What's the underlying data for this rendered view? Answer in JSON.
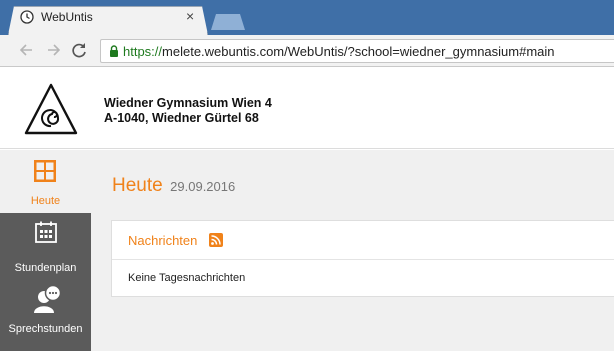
{
  "browser": {
    "tab_title": "WebUntis",
    "close_symbol": "×",
    "url_secure": "https://",
    "url_rest": "melete.webuntis.com/WebUntis/?school=wiedner_gymnasium#main"
  },
  "header": {
    "school_name": "Wiedner Gymnasium Wien 4",
    "school_address": "A-1040, Wiedner Gürtel 68"
  },
  "sidebar": {
    "items": [
      {
        "label": "Heute",
        "icon": "dashboard-grid-icon",
        "active": true
      },
      {
        "label": "Stundenplan",
        "icon": "calendar-icon",
        "active": false
      },
      {
        "label": "Sprechstunden",
        "icon": "consultation-chat-icon",
        "active": false
      }
    ]
  },
  "main": {
    "title": "Heute",
    "date": "29.09.2016",
    "news": {
      "title": "Nachrichten",
      "empty_text": "Keine Tagesnachrichten"
    }
  },
  "colors": {
    "accent": "#f0821a",
    "sidebar_bg": "#5b5b5b",
    "content_bg": "#f0f0f0",
    "browser_frame": "#3f6fa7",
    "secure_green": "#1f7a1f"
  }
}
